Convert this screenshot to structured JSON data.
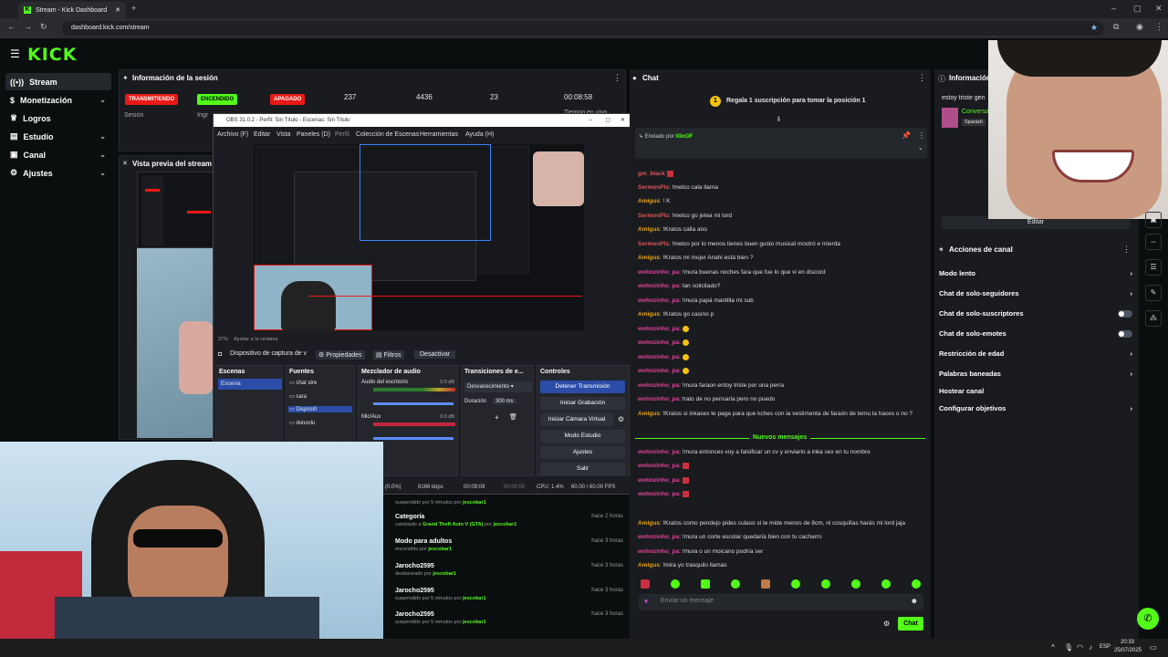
{
  "browser": {
    "tab_title": "Stream - Kick Dashboard",
    "url": "dashboard.kick.com/stream"
  },
  "kick": {
    "logo": "KICK",
    "nav": [
      {
        "label": "Stream",
        "icon": "signal-icon"
      },
      {
        "label": "Monetización",
        "icon": "money-icon"
      },
      {
        "label": "Logros",
        "icon": "trophy-icon"
      },
      {
        "label": "Estudio",
        "icon": "studio-icon"
      },
      {
        "label": "Canal",
        "icon": "channel-icon"
      },
      {
        "label": "Ajustes",
        "icon": "gear-icon"
      }
    ]
  },
  "session": {
    "title": "Información de la sesión",
    "status_live": "TRANSMITIENDO",
    "status_on": "ENCENDIDO",
    "status_off": "APAGADO",
    "sesion_label": "Sesión",
    "ingr_label": "Ingr",
    "espectadores": "237",
    "espectadores_label": "Espectadores",
    "seguidores": "4436",
    "seguidores_label": "Seguidores",
    "cantidad": "23",
    "cantidad_label": "Cantidad de",
    "tiempo": "00:08:58",
    "tiempo_label": "Tiempo en vivo"
  },
  "preview": {
    "title": "Vista previa del stream"
  },
  "obs": {
    "title": "OBS 31.0.2 - Perfil: Sin Título - Escenas: Sin Título",
    "menu": [
      "Archivo (F)",
      "Editar",
      "Vista",
      "Paneles (D)",
      "Perfil",
      "Colección de Escenas",
      "Herramientas",
      "Ayuda (H)"
    ],
    "zoom": "37%",
    "fit": "Ajustar a la ventana",
    "source_bar": "Dispositivo de captura de v",
    "properties": "Propiedades",
    "filters": "Filtros",
    "deactivate": "Desactivar",
    "escenas_title": "Escenas",
    "escena_item": "Escena",
    "fuentes_title": "Fuentes",
    "fuentes": [
      "chat stre",
      "cara",
      "Dispositi",
      "donoclu"
    ],
    "mezclador_title": "Mezclador de audio",
    "audio_desktop": "Audio del escritorio",
    "mic": "Mic/Aux",
    "db1": "0.0 dB",
    "db2": "0.0 dB",
    "trans_title": "Transiciones de e...",
    "trans_value": "Desvanecimiento",
    "duracion_label": "Duración",
    "duracion_value": "300 ms",
    "controles_title": "Controles",
    "btn_stop": "Detener Transmisión",
    "btn_rec": "Iniciar Grabación",
    "btn_vcam": "Iniciar Cámara Virtual",
    "btn_studio": "Modo Estudio",
    "btn_settings": "Ajustes",
    "btn_exit": "Salir",
    "status_drop": "(0.0%)",
    "status_kbps": "8166 kbps",
    "status_time1": "00:09:09",
    "status_time2": "00:00:00",
    "status_cpu": "CPU: 1.4%",
    "status_fps": "60.00 / 60.00 FPS"
  },
  "logs": [
    {
      "title": "",
      "sub": "suspendido por 5 minutos por",
      "by": "jescobar1",
      "time": ""
    },
    {
      "title": "Categoría",
      "sub": "cambiado a",
      "by": "Grand Theft Auto V (GTA)",
      "sub2": "por",
      "by2": "jescobar1",
      "time": "hace 2 horas"
    },
    {
      "title": "Modo para adultos",
      "sub": "encendido por",
      "by": "jescobar1",
      "time": "hace 3 horas"
    },
    {
      "title": "Jarocho2595",
      "sub": "desbaneado por",
      "by": "jescobar1",
      "time": "hace 3 horas"
    },
    {
      "title": "Jarocho2595",
      "sub": "suspendido por 5 minutos por",
      "by": "jescobar1",
      "time": "hace 3 horas"
    },
    {
      "title": "Jarocho2595",
      "sub": "suspendido por 5 minutos por",
      "by": "jescobar1",
      "time": "hace 3 horas"
    }
  ],
  "chat": {
    "title": "Chat",
    "gift_banner": "Regala 1 suscripción para tomar la posición 1",
    "pinned_by_label": "Enviado por",
    "pinned_by_user": "tilinOF",
    "new_messages": "Nuevos mensajes",
    "input_placeholder": "Enviar un mensaje",
    "send": "Chat",
    "messages_top": [
      {
        "user": "gm_black",
        "color": "#e05555",
        "text": ""
      },
      {
        "user": "SermonPls",
        "color": "#e05555",
        "text": "!melco cala llama"
      },
      {
        "user": "Amigus",
        "color": "#e8a317",
        "text": "! K"
      },
      {
        "user": "SermonPls",
        "color": "#e05555",
        "text": "!melco go jetea mi lord"
      },
      {
        "user": "Amigus",
        "color": "#e8a317",
        "text": "!Kratos calla ano"
      },
      {
        "user": "SermonPls",
        "color": "#e05555",
        "text": "!melco por lo menos tienes buen gusto musical mostró e mierda"
      },
      {
        "user": "Amigus",
        "color": "#e8a317",
        "text": "!Kratos mi mujer Anahi está bien ?"
      },
      {
        "user": "wohnzinho_pa",
        "color": "#e0449a",
        "text": "!mura buenas noches fara que fue lo que vi en discord"
      },
      {
        "user": "wohnzinho_pa",
        "color": "#e0449a",
        "text": "tan solicitado?"
      },
      {
        "user": "wohnzinho_pa",
        "color": "#e0449a",
        "text": "!mura papá mantilla mi sub"
      },
      {
        "user": "Amigus",
        "color": "#e8a317",
        "text": "!Kratos go casino p"
      },
      {
        "user": "wohnzinho_pa",
        "color": "#e0449a",
        "text": ""
      },
      {
        "user": "wohnzinho_pa",
        "color": "#e0449a",
        "text": ""
      },
      {
        "user": "wohnzinho_pa",
        "color": "#e0449a",
        "text": ""
      },
      {
        "user": "wohnzinho_pa",
        "color": "#e0449a",
        "text": ""
      },
      {
        "user": "wohnzinho_pa",
        "color": "#e0449a",
        "text": "!mura faraon entoy triste por una perra"
      },
      {
        "user": "wohnzinho_pa",
        "color": "#e0449a",
        "text": "trato de no pensarla pero no puedo"
      },
      {
        "user": "Amigus",
        "color": "#e8a317",
        "text": "!Kratos si inkasex te paga para que kches con la vestimenta de faraón de temu la haces o no ?"
      }
    ],
    "messages_bottom": [
      {
        "user": "wohnzinho_pa",
        "color": "#e0449a",
        "text": "!mura entonces voy a falsificar un cv y enviarlo a inka sex en tu nombre"
      },
      {
        "user": "wohnzinho_pa",
        "color": "#e0449a",
        "text": ""
      },
      {
        "user": "wohnzinho_pa",
        "color": "#e0449a",
        "text": ""
      },
      {
        "user": "wohnzinho_pa",
        "color": "#e0449a",
        "text": ""
      },
      {
        "user": "Amigus",
        "color": "#e8a317",
        "text": "!Kratos como pendejo pides culaso si te mide menos de 8cm, ni cosquillas harás mi lord jaja"
      },
      {
        "user": "wohnzinho_pa",
        "color": "#e0449a",
        "text": "!mura un corte escolar quedaría bien con tu cacharro"
      },
      {
        "user": "wohnzinho_pa",
        "color": "#e0449a",
        "text": "!mura o un moicano podría ser"
      },
      {
        "user": "Amigus",
        "color": "#e8a317",
        "text": "!mira yo trasquilo llamas"
      }
    ]
  },
  "info": {
    "title": "Información de",
    "stream_title": "estoy triste gen",
    "category": "Conversa",
    "language": "Spanish",
    "edit": "Editar"
  },
  "actions": {
    "title": "Acciones de canal",
    "items": [
      {
        "label": "Modo lento",
        "control": "chevron"
      },
      {
        "label": "Chat de solo-seguidores",
        "control": "chevron"
      },
      {
        "label": "Chat de solo-suscriptores",
        "control": "toggle"
      },
      {
        "label": "Chat de solo-emotes",
        "control": "toggle"
      },
      {
        "label": "Restricción de edad",
        "control": "chevron"
      },
      {
        "label": "Palabras baneadas",
        "control": "chevron"
      },
      {
        "label": "Hostear canal",
        "control": "none"
      },
      {
        "label": "Configurar objetivos",
        "control": "chevron"
      }
    ]
  },
  "taskbar": {
    "lang": "ESP",
    "time": "20:33",
    "date": "25/07/2025"
  },
  "colors": {
    "accent": "#53fc18",
    "live": "#e91916",
    "bg": "#0b0e0f",
    "panel": "#191b1f"
  }
}
